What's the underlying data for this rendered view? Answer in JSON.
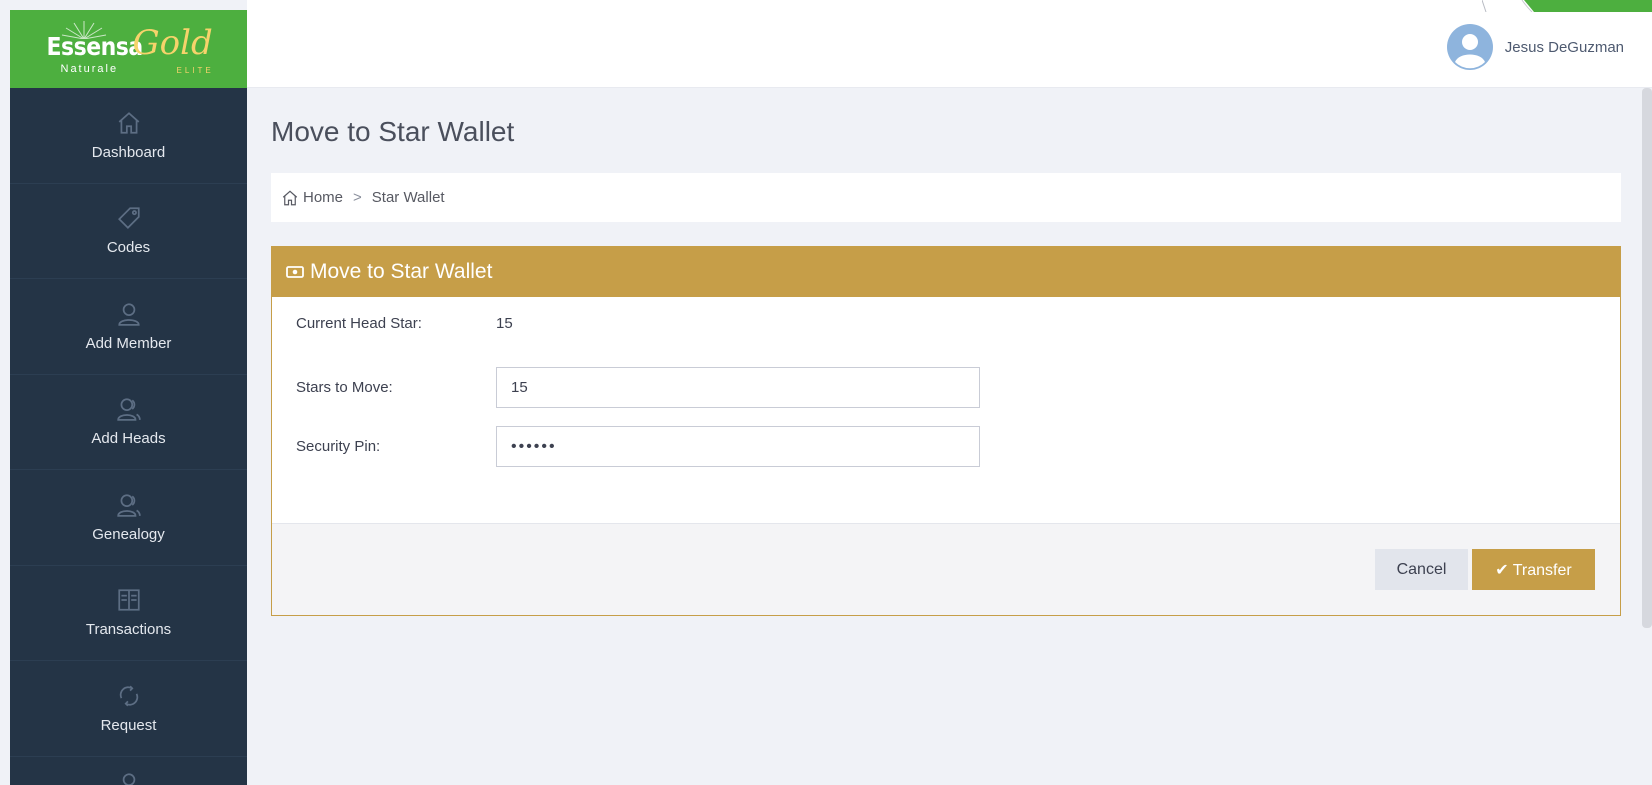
{
  "brand": {
    "essensa": "Essensa",
    "naturale": "Naturale",
    "gold": "Gold",
    "elite": "ELITE"
  },
  "sidebar": {
    "items": [
      {
        "label": "Dashboard",
        "icon": "home-icon"
      },
      {
        "label": "Codes",
        "icon": "tag-icon"
      },
      {
        "label": "Add Member",
        "icon": "user-icon"
      },
      {
        "label": "Add Heads",
        "icon": "users-icon"
      },
      {
        "label": "Genealogy",
        "icon": "users-icon"
      },
      {
        "label": "Transactions",
        "icon": "book-icon"
      },
      {
        "label": "Request",
        "icon": "refresh-icon"
      }
    ]
  },
  "header": {
    "user_name": "Jesus DeGuzman"
  },
  "page": {
    "title": "Move to Star Wallet"
  },
  "breadcrumb": {
    "home": "Home",
    "separator": ">",
    "current": "Star Wallet"
  },
  "portlet": {
    "title": "Move to Star Wallet",
    "fields": {
      "current_head_star_label": "Current Head Star:",
      "current_head_star_value": "15",
      "stars_to_move_label": "Stars to Move:",
      "stars_to_move_value": "15",
      "security_pin_label": "Security Pin:",
      "security_pin_value": "••••••"
    },
    "buttons": {
      "cancel": "Cancel",
      "transfer": "Transfer"
    }
  },
  "colors": {
    "brand_green": "#4daf3f",
    "sidebar_bg": "#243446",
    "accent_gold": "#c69e48"
  }
}
